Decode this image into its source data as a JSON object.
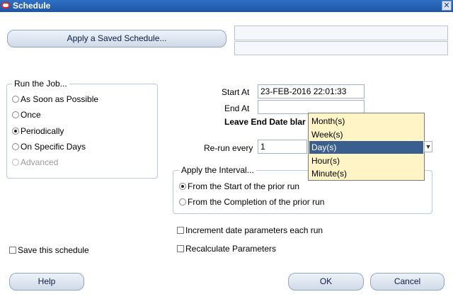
{
  "window": {
    "title": "Schedule",
    "close_symbol": "✕"
  },
  "top": {
    "apply_saved_label": "Apply a Saved Schedule...",
    "saved_field_1": "",
    "saved_field_2": ""
  },
  "run_job": {
    "legend": "Run the Job...",
    "options": [
      {
        "label": "As Soon as Possible",
        "selected": false,
        "disabled": false
      },
      {
        "label": "Once",
        "selected": false,
        "disabled": false
      },
      {
        "label": "Periodically",
        "selected": true,
        "disabled": false
      },
      {
        "label": "On Specific Days",
        "selected": false,
        "disabled": false
      },
      {
        "label": "Advanced",
        "selected": false,
        "disabled": true
      }
    ]
  },
  "form": {
    "start_at_label": "Start At",
    "start_at_value": "23-FEB-2016 22:01:33",
    "end_at_label": "End At",
    "end_at_value": "",
    "leave_end_note": "Leave End Date blar",
    "rerun_label": "Re-run every",
    "rerun_value": "1"
  },
  "unit_dropdown": {
    "items": [
      "Month(s)",
      "Week(s)",
      "Day(s)",
      "Hour(s)",
      "Minute(s)"
    ],
    "selected_index": 2
  },
  "interval": {
    "legend": "Apply the Interval...",
    "options": [
      {
        "label": "From the Start of the prior run",
        "selected": true
      },
      {
        "label": "From the Completion of the prior run",
        "selected": false
      }
    ]
  },
  "checks": {
    "increment_label": "Increment date parameters each run",
    "recalculate_label": "Recalculate Parameters",
    "save_schedule_label": "Save this schedule"
  },
  "buttons": {
    "help": "Help",
    "ok": "OK",
    "cancel": "Cancel"
  }
}
